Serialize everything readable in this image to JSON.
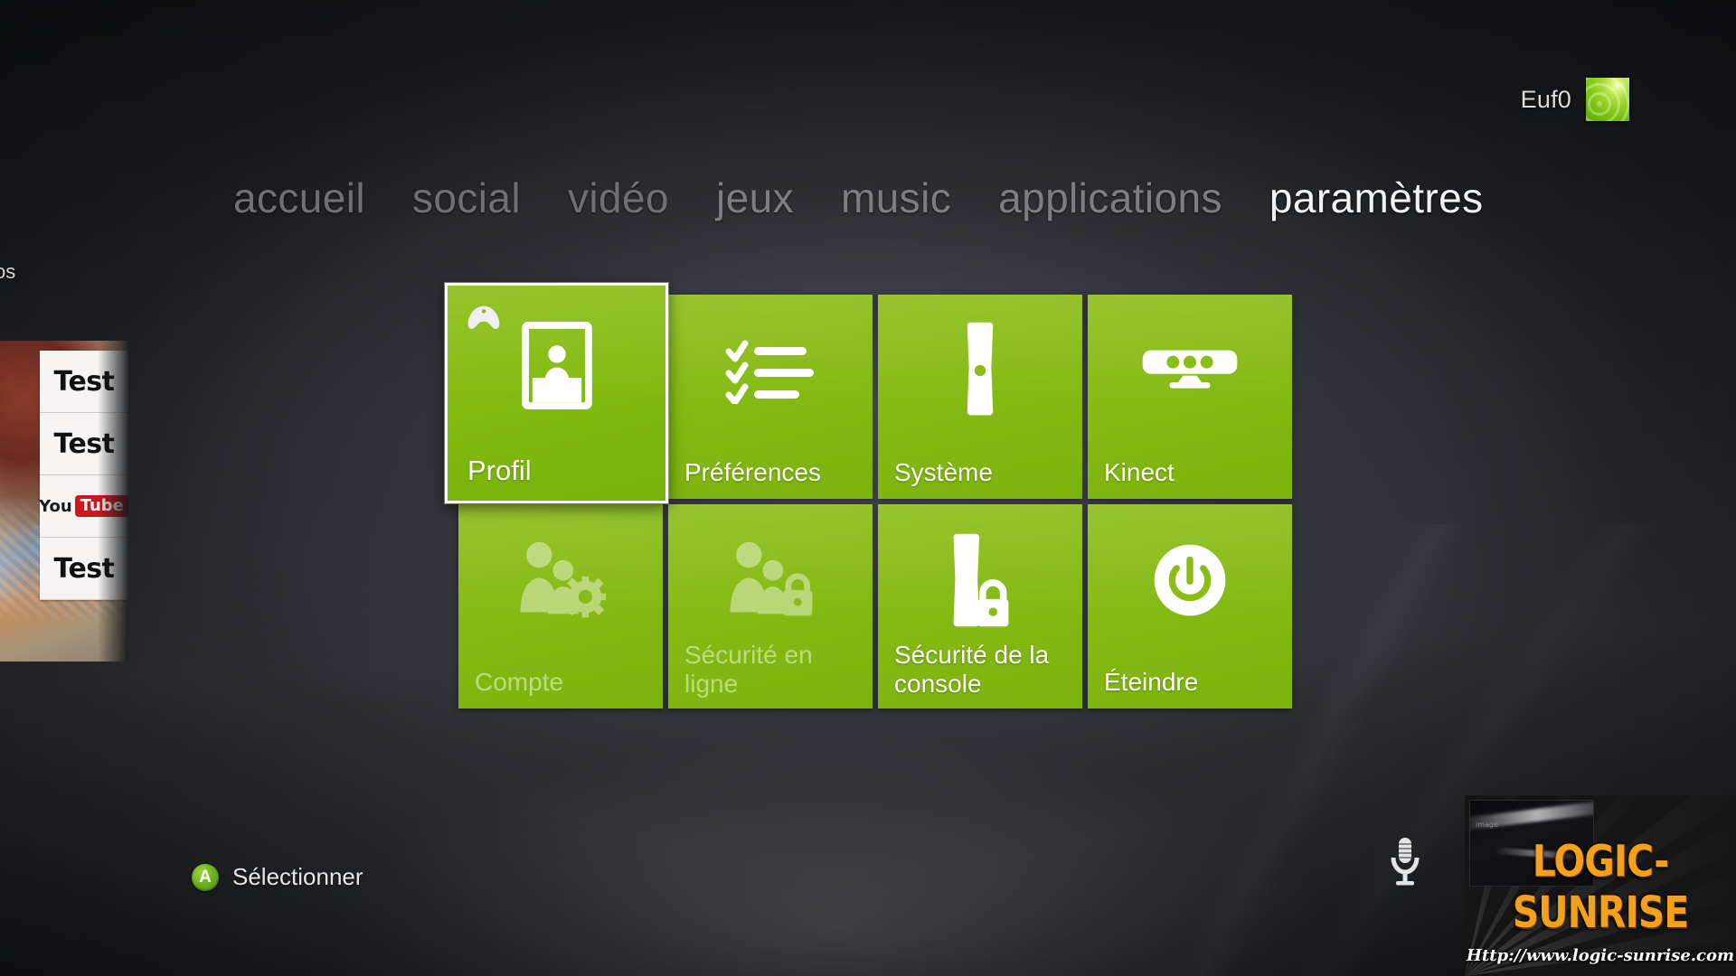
{
  "header": {
    "gamertag": "Euf0",
    "gamerpic_icon": "gamerpic-green-rings"
  },
  "nav": {
    "items": [
      {
        "label": "accueil",
        "active": false
      },
      {
        "label": "social",
        "active": false
      },
      {
        "label": "vidéo",
        "active": false
      },
      {
        "label": "jeux",
        "active": false
      },
      {
        "label": "music",
        "active": false
      },
      {
        "label": "applications",
        "active": false
      },
      {
        "label": "paramètres",
        "active": true
      }
    ]
  },
  "tiles": [
    {
      "label": "Profil",
      "icon": "profile-card-icon",
      "selected": true,
      "disabled": false,
      "badge": "xbox-controller-icon"
    },
    {
      "label": "Préférences",
      "icon": "checklist-icon",
      "selected": false,
      "disabled": false,
      "badge": null
    },
    {
      "label": "Système",
      "icon": "console-icon",
      "selected": false,
      "disabled": false,
      "badge": null
    },
    {
      "label": "Kinect",
      "icon": "kinect-sensor-icon",
      "selected": false,
      "disabled": false,
      "badge": null
    },
    {
      "label": "Compte",
      "icon": "people-gear-icon",
      "selected": false,
      "disabled": true,
      "badge": null
    },
    {
      "label": "Sécurité en ligne",
      "icon": "people-lock-icon",
      "selected": false,
      "disabled": true,
      "badge": null
    },
    {
      "label": "Sécurité de la console",
      "icon": "console-lock-icon",
      "selected": false,
      "disabled": false,
      "badge": null
    },
    {
      "label": "Éteindre",
      "icon": "power-icon",
      "selected": false,
      "disabled": false,
      "badge": null
    }
  ],
  "hint": {
    "button": "A",
    "label": "Sélectionner"
  },
  "voice": {
    "icon": "microphone-icon"
  },
  "left_panel": {
    "tiles": [
      {
        "label": "Test",
        "kind": "text"
      },
      {
        "label": "Test",
        "kind": "text"
      },
      {
        "label": "YouTube",
        "kind": "youtube-logo"
      },
      {
        "label": "Test",
        "kind": "text"
      }
    ],
    "caption": "os"
  },
  "watermark": {
    "title": "LOGIC-SUNRISE",
    "url": "Http://www.logic-sunrise.com"
  },
  "colors": {
    "tile_green": "#85bb14",
    "tile_green_dark": "#79b009",
    "accent_white": "#ffffff",
    "nav_inactive": "#6d7175",
    "nav_active": "#f2f2f2",
    "a_button_green": "#6eb320",
    "watermark_orange": "#f5a01b",
    "youtube_red": "#cc181e",
    "background_dark": "#1d2023"
  }
}
